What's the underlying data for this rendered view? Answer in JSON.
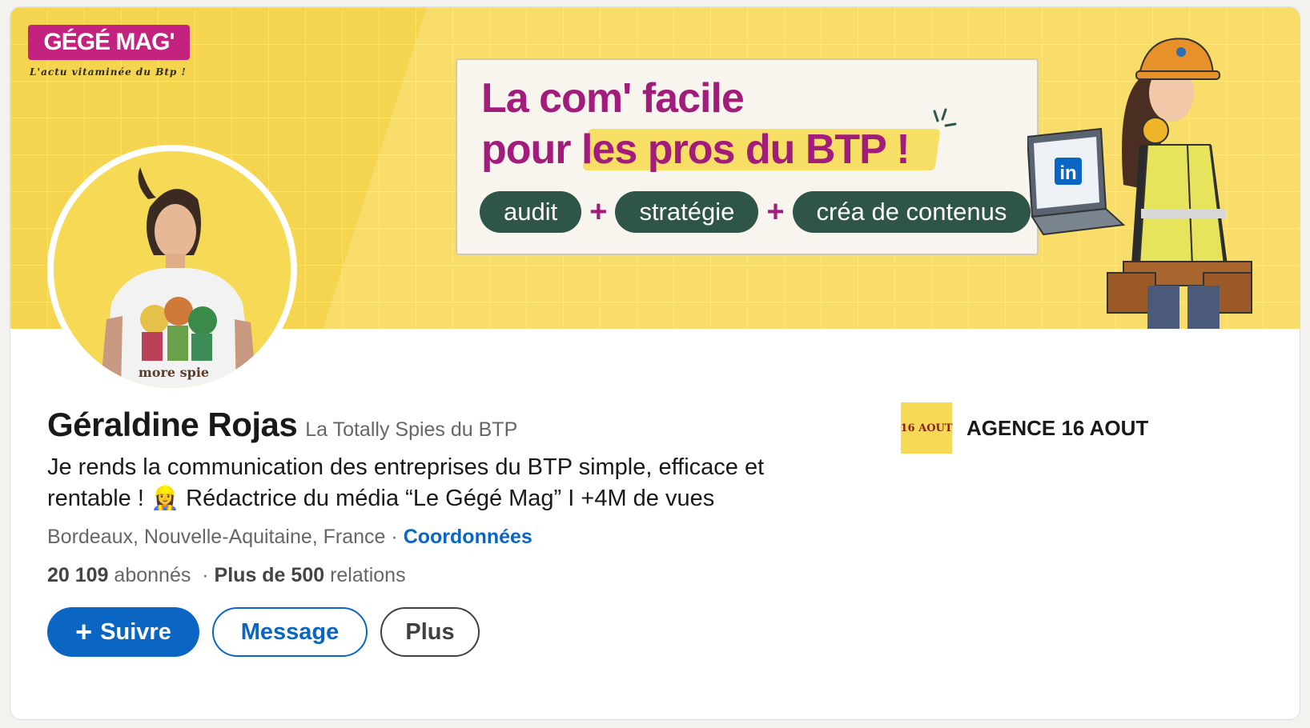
{
  "banner": {
    "logo_text": "GÉGÉ MAG'",
    "logo_tagline": "L'actu vitaminée du Btp !",
    "promo_line1": "La com' facile",
    "promo_line2": "pour les pros du BTP !",
    "pills": [
      "audit",
      "stratégie",
      "créa de contenus"
    ],
    "plus_sign": "+",
    "laptop_badge": "in"
  },
  "profile": {
    "name": "Géraldine Rojas",
    "pronoun_tagline": "La Totally Spies du BTP",
    "headline": "Je rends la communication des entreprises du BTP simple, efficace et rentable ! 👷‍♀️ Rédactrice du média “Le Gégé Mag” I +4M de vues",
    "location": "Bordeaux, Nouvelle-Aquitaine, France",
    "separator": "·",
    "contact_link": "Coordonnées",
    "followers_count": "20 109",
    "followers_label": "abonnés",
    "connections_count": "Plus de 500",
    "connections_label": "relations",
    "shirt_text": "more spie"
  },
  "actions": {
    "follow_icon": "+",
    "follow_label": "Suivre",
    "message_label": "Message",
    "more_label": "Plus"
  },
  "company": {
    "logo_text": "16 AOUT",
    "name": "AGENCE 16 AOUT"
  },
  "colors": {
    "brand_blue": "#0a66c2",
    "banner_yellow": "#f8dd6a",
    "accent_magenta": "#a21c7c",
    "pill_green": "#2e5547"
  }
}
